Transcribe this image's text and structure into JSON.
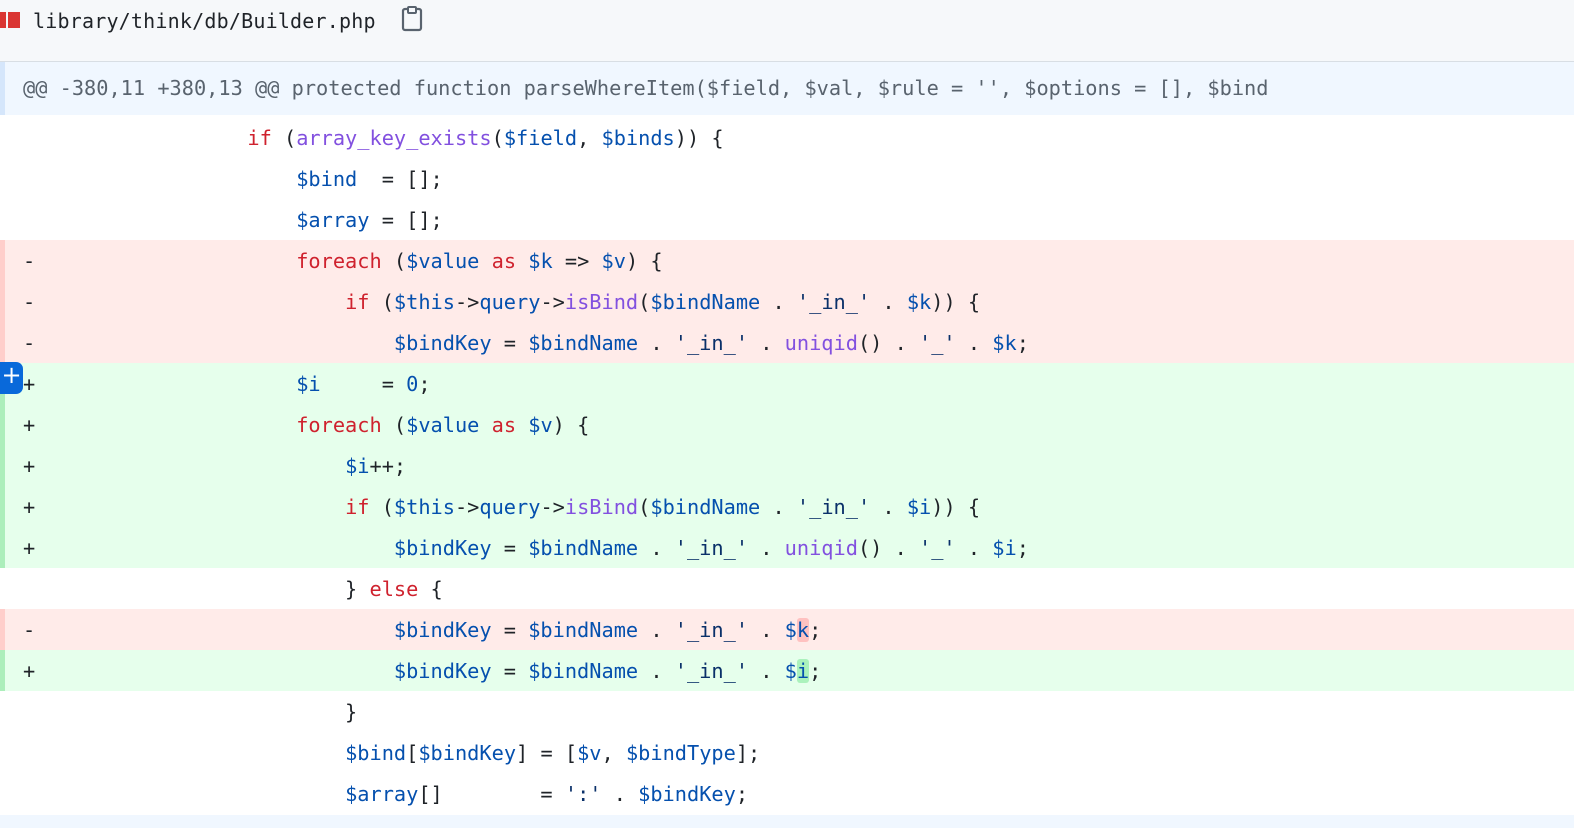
{
  "file": {
    "name": "library/think/db/Builder.php",
    "copy_icon": "copy-clipboard-icon"
  },
  "hunk": {
    "header": "@@ -380,11 +380,13 @@ protected function parseWhereItem($field, $val, $rule = '', $options = [], $bind"
  },
  "colors": {
    "deleted": "#ffebe9",
    "added": "#e6ffec",
    "hunk": "#f0f7ff",
    "keyword": "#cf222e",
    "variable": "#0550ae",
    "function": "#8250df"
  },
  "add_comment_button": "+",
  "lines": [
    {
      "type": "ctx",
      "marker": "",
      "tokens": [
        [
          "p",
          "                "
        ],
        [
          "k",
          "if"
        ],
        [
          "p",
          " ("
        ],
        [
          "f",
          "array_key_exists"
        ],
        [
          "p",
          "("
        ],
        [
          "v",
          "$field"
        ],
        [
          "p",
          ", "
        ],
        [
          "v",
          "$binds"
        ],
        [
          "p",
          ")) {"
        ]
      ]
    },
    {
      "type": "ctx",
      "marker": "",
      "tokens": [
        [
          "p",
          "                    "
        ],
        [
          "v",
          "$bind"
        ],
        [
          "p",
          "  = [];"
        ]
      ]
    },
    {
      "type": "ctx",
      "marker": "",
      "tokens": [
        [
          "p",
          "                    "
        ],
        [
          "v",
          "$array"
        ],
        [
          "p",
          " = [];"
        ]
      ]
    },
    {
      "type": "del",
      "marker": "-",
      "tokens": [
        [
          "p",
          "                    "
        ],
        [
          "k",
          "foreach"
        ],
        [
          "p",
          " ("
        ],
        [
          "v",
          "$value"
        ],
        [
          "p",
          " "
        ],
        [
          "k",
          "as"
        ],
        [
          "p",
          " "
        ],
        [
          "v",
          "$k"
        ],
        [
          "p",
          " => "
        ],
        [
          "v",
          "$v"
        ],
        [
          "p",
          ") {"
        ]
      ]
    },
    {
      "type": "del",
      "marker": "-",
      "tokens": [
        [
          "p",
          "                        "
        ],
        [
          "k",
          "if"
        ],
        [
          "p",
          " ("
        ],
        [
          "v",
          "$this"
        ],
        [
          "p",
          "->"
        ],
        [
          "v",
          "query"
        ],
        [
          "p",
          "->"
        ],
        [
          "f",
          "isBind"
        ],
        [
          "p",
          "("
        ],
        [
          "v",
          "$bindName"
        ],
        [
          "p",
          " . "
        ],
        [
          "s",
          "'_in_'"
        ],
        [
          "p",
          " . "
        ],
        [
          "v",
          "$k"
        ],
        [
          "p",
          ")) {"
        ]
      ]
    },
    {
      "type": "del",
      "marker": "-",
      "tokens": [
        [
          "p",
          "                            "
        ],
        [
          "v",
          "$bindKey"
        ],
        [
          "p",
          " = "
        ],
        [
          "v",
          "$bindName"
        ],
        [
          "p",
          " . "
        ],
        [
          "s",
          "'_in_'"
        ],
        [
          "p",
          " . "
        ],
        [
          "f",
          "uniqid"
        ],
        [
          "p",
          "() . "
        ],
        [
          "s",
          "'_'"
        ],
        [
          "p",
          " . "
        ],
        [
          "v",
          "$k"
        ],
        [
          "p",
          ";"
        ]
      ]
    },
    {
      "type": "add",
      "marker": "+",
      "tokens": [
        [
          "p",
          "                    "
        ],
        [
          "v",
          "$i"
        ],
        [
          "p",
          "     = "
        ],
        [
          "n",
          "0"
        ],
        [
          "p",
          ";"
        ]
      ]
    },
    {
      "type": "add",
      "marker": "+",
      "tokens": [
        [
          "p",
          "                    "
        ],
        [
          "k",
          "foreach"
        ],
        [
          "p",
          " ("
        ],
        [
          "v",
          "$value"
        ],
        [
          "p",
          " "
        ],
        [
          "k",
          "as"
        ],
        [
          "p",
          " "
        ],
        [
          "v",
          "$v"
        ],
        [
          "p",
          ") {"
        ]
      ]
    },
    {
      "type": "add",
      "marker": "+",
      "tokens": [
        [
          "p",
          "                        "
        ],
        [
          "v",
          "$i"
        ],
        [
          "p",
          "++;"
        ]
      ]
    },
    {
      "type": "add",
      "marker": "+",
      "tokens": [
        [
          "p",
          "                        "
        ],
        [
          "k",
          "if"
        ],
        [
          "p",
          " ("
        ],
        [
          "v",
          "$this"
        ],
        [
          "p",
          "->"
        ],
        [
          "v",
          "query"
        ],
        [
          "p",
          "->"
        ],
        [
          "f",
          "isBind"
        ],
        [
          "p",
          "("
        ],
        [
          "v",
          "$bindName"
        ],
        [
          "p",
          " . "
        ],
        [
          "s",
          "'_in_'"
        ],
        [
          "p",
          " . "
        ],
        [
          "v",
          "$i"
        ],
        [
          "p",
          ")) {"
        ]
      ]
    },
    {
      "type": "add",
      "marker": "+",
      "tokens": [
        [
          "p",
          "                            "
        ],
        [
          "v",
          "$bindKey"
        ],
        [
          "p",
          " = "
        ],
        [
          "v",
          "$bindName"
        ],
        [
          "p",
          " . "
        ],
        [
          "s",
          "'_in_'"
        ],
        [
          "p",
          " . "
        ],
        [
          "f",
          "uniqid"
        ],
        [
          "p",
          "() . "
        ],
        [
          "s",
          "'_'"
        ],
        [
          "p",
          " . "
        ],
        [
          "v",
          "$i"
        ],
        [
          "p",
          ";"
        ]
      ]
    },
    {
      "type": "ctx",
      "marker": "",
      "tokens": [
        [
          "p",
          "                        } "
        ],
        [
          "k",
          "else"
        ],
        [
          "p",
          " {"
        ]
      ]
    },
    {
      "type": "del",
      "marker": "-",
      "tokens": [
        [
          "p",
          "                            "
        ],
        [
          "v",
          "$bindKey"
        ],
        [
          "p",
          " = "
        ],
        [
          "v",
          "$bindName"
        ],
        [
          "p",
          " . "
        ],
        [
          "s",
          "'_in_'"
        ],
        [
          "p",
          " . "
        ],
        [
          "v",
          "$"
        ],
        [
          "v!",
          "k"
        ],
        [
          "p",
          ";"
        ]
      ]
    },
    {
      "type": "add",
      "marker": "+",
      "tokens": [
        [
          "p",
          "                            "
        ],
        [
          "v",
          "$bindKey"
        ],
        [
          "p",
          " = "
        ],
        [
          "v",
          "$bindName"
        ],
        [
          "p",
          " . "
        ],
        [
          "s",
          "'_in_'"
        ],
        [
          "p",
          " . "
        ],
        [
          "v",
          "$"
        ],
        [
          "v!",
          "i"
        ],
        [
          "p",
          ";"
        ]
      ]
    },
    {
      "type": "ctx",
      "marker": "",
      "tokens": [
        [
          "p",
          "                        }"
        ]
      ]
    },
    {
      "type": "ctx",
      "marker": "",
      "tokens": [
        [
          "p",
          "                        "
        ],
        [
          "v",
          "$bind"
        ],
        [
          "p",
          "["
        ],
        [
          "v",
          "$bindKey"
        ],
        [
          "p",
          "] = ["
        ],
        [
          "v",
          "$v"
        ],
        [
          "p",
          ", "
        ],
        [
          "v",
          "$bindType"
        ],
        [
          "p",
          "];"
        ]
      ]
    },
    {
      "type": "ctx",
      "marker": "",
      "tokens": [
        [
          "p",
          "                        "
        ],
        [
          "v",
          "$array"
        ],
        [
          "p",
          "[]        = "
        ],
        [
          "s",
          "':'"
        ],
        [
          "p",
          " . "
        ],
        [
          "v",
          "$bindKey"
        ],
        [
          "p",
          ";"
        ]
      ]
    }
  ]
}
